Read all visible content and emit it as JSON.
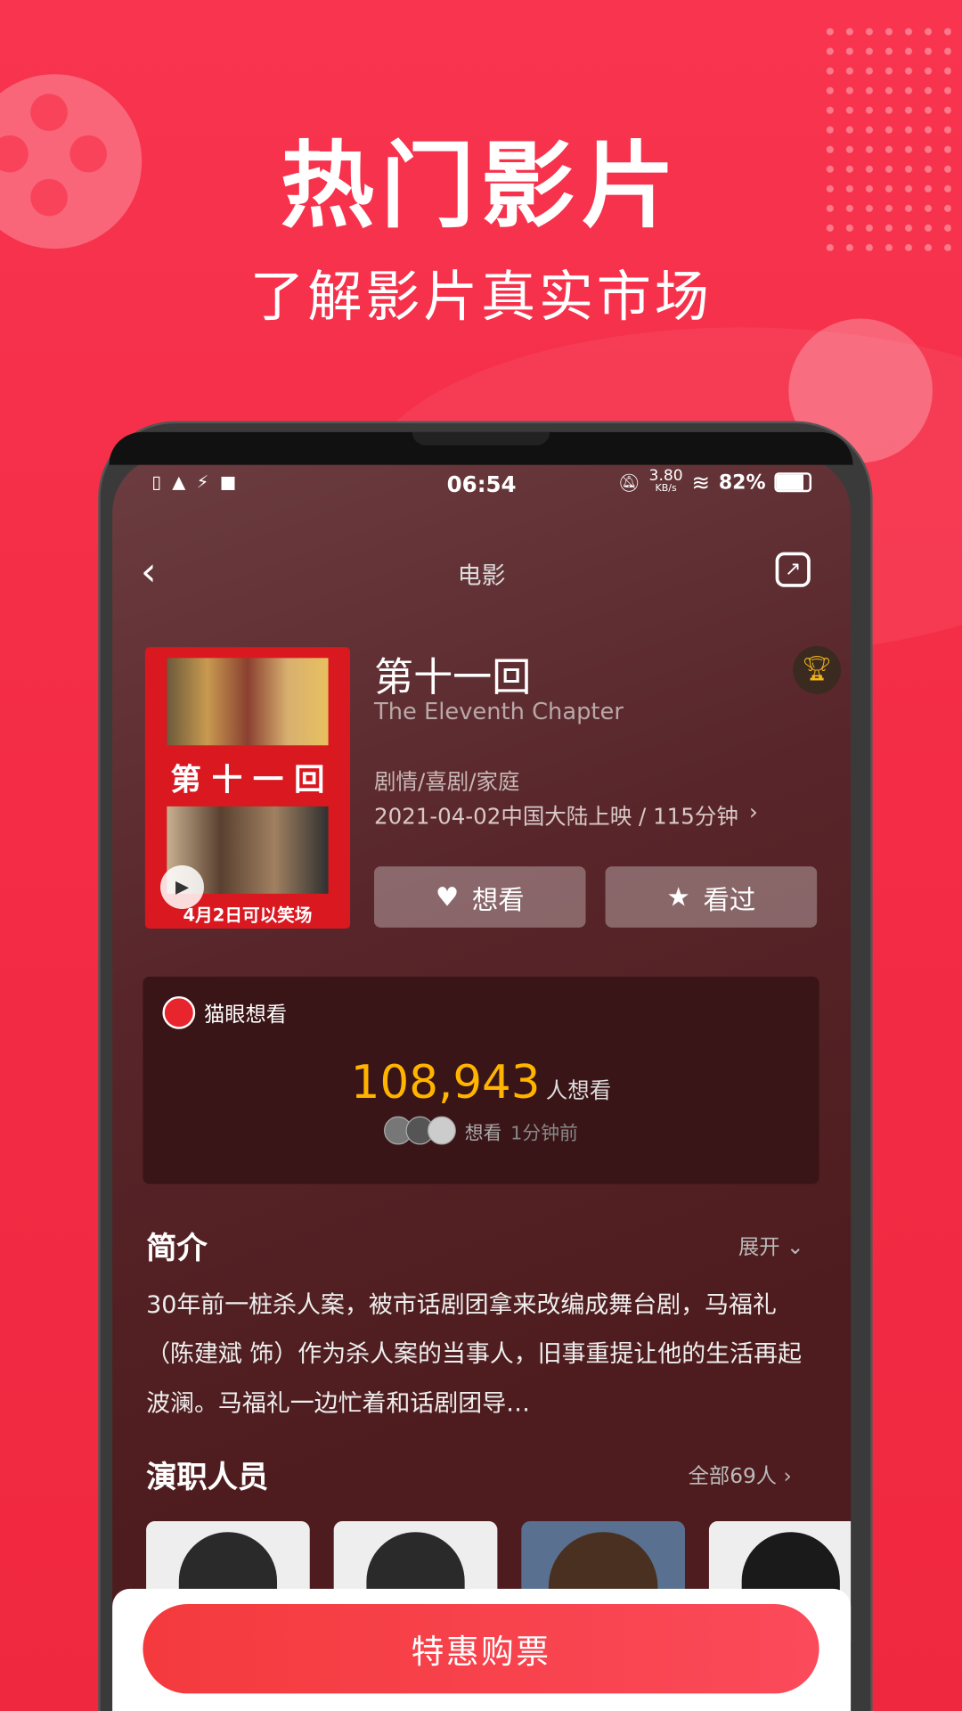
{
  "promo": {
    "title": "热门影片",
    "subtitle": "了解影片真实市场"
  },
  "status_bar": {
    "time": "06:54",
    "net_speed": "3.80",
    "net_unit": "KB/s",
    "battery": "82%"
  },
  "nav": {
    "title": "电影"
  },
  "movie": {
    "title": "第十一回",
    "english_title": "The Eleventh Chapter",
    "genres": "剧情/喜剧/家庭",
    "release": "2021-04-02中国大陆上映 / 115分钟",
    "poster_title": "第 十 一 回",
    "poster_tagline": "4月2日可以笑场"
  },
  "actions": {
    "want": "想看",
    "watched": "看过"
  },
  "maoyan": {
    "label": "猫眼想看",
    "count": "108,943",
    "count_suffix": "人想看",
    "recent_action": "想看",
    "recent_time": "1分钟前"
  },
  "synopsis": {
    "heading": "简介",
    "expand": "展开",
    "text": "30年前一桩杀人案，被市话剧团拿来改编成舞台剧，马福礼（陈建斌 饰）作为杀人案的当事人，旧事重提让他的生活再起波澜。马福礼一边忙着和话剧团导…"
  },
  "cast": {
    "heading": "演职人员",
    "all": "全部69人"
  },
  "buy_button": "特惠购票",
  "colors": {
    "brand": "#f8344e",
    "count": "#ffb400"
  }
}
